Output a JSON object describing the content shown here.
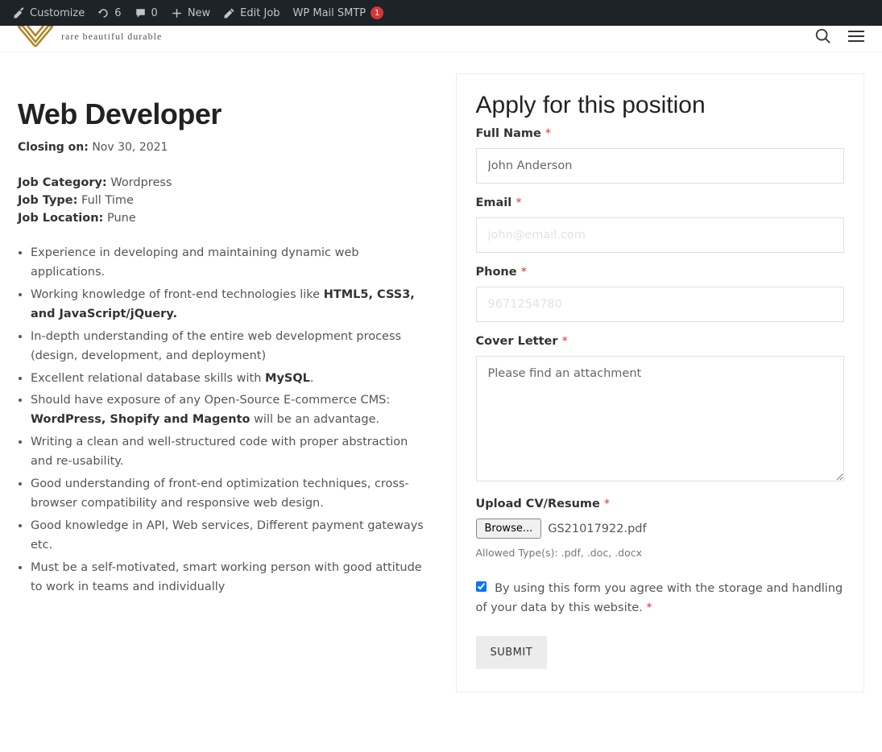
{
  "admin_bar": {
    "customize": "Customize",
    "refresh_count": "6",
    "comments_count": "0",
    "new": "New",
    "edit_job": "Edit Job",
    "wp_mail": "WP Mail SMTP",
    "mail_badge": "1"
  },
  "header": {
    "tagline": "rare beautiful durable"
  },
  "job": {
    "title": "Web Developer",
    "closing_label": "Closing on:",
    "closing_value": "Nov 30, 2021",
    "meta_category_label": "Job Category:",
    "meta_category_value": "Wordpress",
    "meta_type_label": "Job Type:",
    "meta_type_value": "Full Time",
    "meta_location_label": "Job Location:",
    "meta_location_value": "Pune",
    "req_0": "Experience in developing and maintaining dynamic web applications.",
    "req_1_pre": "Working knowledge of front-end technologies like ",
    "req_1_bold": "HTML5, CSS3, and JavaScript/jQuery.",
    "req_2": "In-depth understanding of the entire web development process (design, development, and deployment)",
    "req_3_pre": "Excellent relational database skills with ",
    "req_3_bold": "MySQL",
    "req_3_post": ".",
    "req_4_pre": "Should have exposure of any Open-Source E-commerce CMS: ",
    "req_4_bold": "WordPress, Shopify and Magento",
    "req_4_post": " will be an advantage.",
    "req_5": "Writing a clean and well-structured code with proper abstraction and re-usability.",
    "req_6": "Good understanding of front-end optimization techniques, cross-browser compatibility and responsive web design.",
    "req_7": "Good knowledge in API, Web services, Different payment gateways etc.",
    "req_8": "Must be a self-motivated, smart working person with good attitude to work in teams and individually"
  },
  "form": {
    "title": "Apply for this position",
    "full_name_label": "Full Name",
    "full_name_value": "John Anderson",
    "email_label": "Email",
    "email_value": "john@email.com",
    "phone_label": "Phone",
    "phone_value": "9671254780",
    "cover_label": "Cover Letter",
    "cover_value": "Please find an attachment",
    "upload_label": "Upload CV/Resume",
    "browse_label": "Browse...",
    "file_name": "GS21017922.pdf",
    "allowed_types": "Allowed Type(s): .pdf, .doc, .docx",
    "consent_text_a": "By using this form you agree with the storage and handling of your data by this website. ",
    "submit_label": "SUBMIT"
  }
}
